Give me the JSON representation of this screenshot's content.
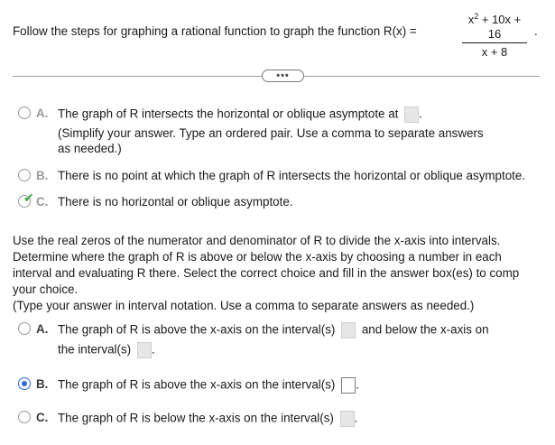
{
  "question": {
    "prefix": "Follow the steps for graphing a rational function to graph the function R(x) =",
    "numerator_a": "x",
    "numerator_exp": "2",
    "numerator_b": " + 10x + 16",
    "denominator": "x + 8",
    "period": "."
  },
  "expand_button": {
    "label": "•••"
  },
  "part1": {
    "options": [
      {
        "letter": "A.",
        "text": "The graph of R intersects the horizontal or oblique asymptote at",
        "after_box": ".",
        "hint": "(Simplify your answer. Type an ordered pair. Use a comma to separate answers as needed.)",
        "hint_line1": "(Simplify your answer. Type an ordered pair. Use a comma to separate answers",
        "hint_line2": "as needed.)"
      },
      {
        "letter": "B.",
        "text": "There is no point at which the graph of R intersects the horizontal or oblique asymptote."
      },
      {
        "letter": "C.",
        "text": "There is no horizontal or oblique asymptote.",
        "status": "correct"
      }
    ]
  },
  "part2": {
    "line1": "Use the real zeros of the numerator and denominator of R to divide the x-axis into intervals.",
    "line2": "Determine where the graph of R is above or below the x-axis by choosing a number in each",
    "line3": "interval and evaluating R there. Select the correct choice and fill in the answer box(es) to comp",
    "line4": "your choice.",
    "line5": "(Type your answer in interval notation. Use a comma to separate answers as needed.)",
    "options": [
      {
        "letter": "A.",
        "text1": "The graph of R is above the x-axis on the interval(s)",
        "text2": "and below the x-axis on",
        "text3": "the interval(s)",
        "after_box": "."
      },
      {
        "letter": "B.",
        "text": "The graph of R is above the x-axis on the interval(s)",
        "after_box": ".",
        "selected": true
      },
      {
        "letter": "C.",
        "text": "The graph of R is below the x-axis on the interval(s)",
        "after_box": "."
      }
    ]
  }
}
